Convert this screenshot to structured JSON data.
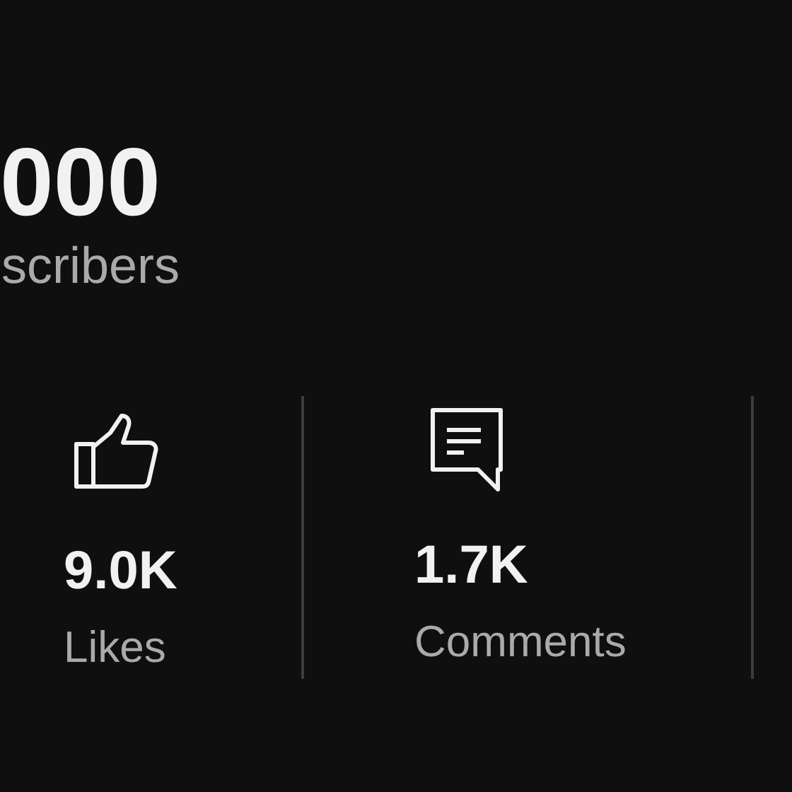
{
  "subscribers": {
    "value": "000",
    "label": "scribers"
  },
  "stats": [
    {
      "kind": "likes",
      "value": "9.0K",
      "label": "Likes"
    },
    {
      "kind": "comments",
      "value": "1.7K",
      "label": "Comments"
    }
  ]
}
